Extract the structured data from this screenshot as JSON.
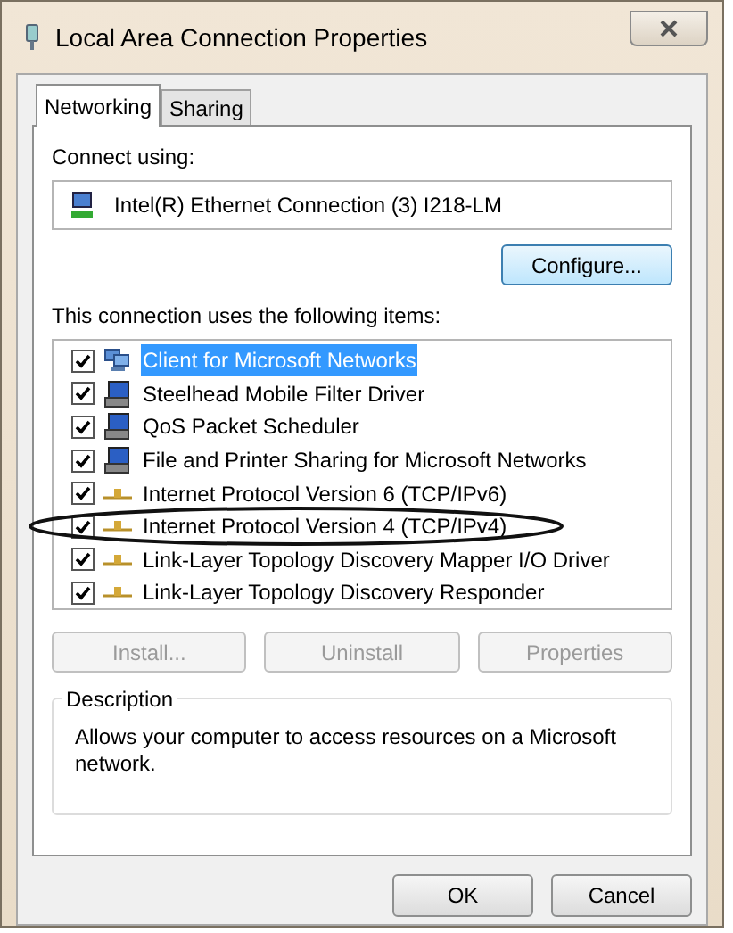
{
  "window": {
    "title": "Local Area Connection Properties"
  },
  "tabs": [
    {
      "label": "Networking",
      "selected": true
    },
    {
      "label": "Sharing",
      "selected": false
    }
  ],
  "connect_using": {
    "label": "Connect using:",
    "adapter": "Intel(R) Ethernet Connection (3) I218-LM"
  },
  "configure_button": "Configure...",
  "items_label": "This connection uses the following items:",
  "items": [
    {
      "label": "Client for Microsoft Networks",
      "kind": "client",
      "checked": true,
      "selected": true,
      "circled": false
    },
    {
      "label": "Steelhead Mobile Filter Driver",
      "kind": "service",
      "checked": true,
      "selected": false,
      "circled": false
    },
    {
      "label": "QoS Packet Scheduler",
      "kind": "service",
      "checked": true,
      "selected": false,
      "circled": false
    },
    {
      "label": "File and Printer Sharing for Microsoft Networks",
      "kind": "service",
      "checked": true,
      "selected": false,
      "circled": false
    },
    {
      "label": "Internet Protocol Version 6 (TCP/IPv6)",
      "kind": "protocol",
      "checked": true,
      "selected": false,
      "circled": false
    },
    {
      "label": "Internet Protocol Version 4 (TCP/IPv4)",
      "kind": "protocol",
      "checked": true,
      "selected": false,
      "circled": true
    },
    {
      "label": "Link-Layer Topology Discovery Mapper I/O Driver",
      "kind": "protocol",
      "checked": true,
      "selected": false,
      "circled": false
    },
    {
      "label": "Link-Layer Topology Discovery Responder",
      "kind": "protocol",
      "checked": true,
      "selected": false,
      "circled": false
    }
  ],
  "item_buttons": [
    {
      "label": "Install...",
      "disabled": true
    },
    {
      "label": "Uninstall",
      "disabled": true
    },
    {
      "label": "Properties",
      "disabled": true
    }
  ],
  "description": {
    "title": "Description",
    "text": "Allows your computer to access resources on a Microsoft network."
  },
  "dialog_buttons": [
    "OK",
    "Cancel"
  ]
}
